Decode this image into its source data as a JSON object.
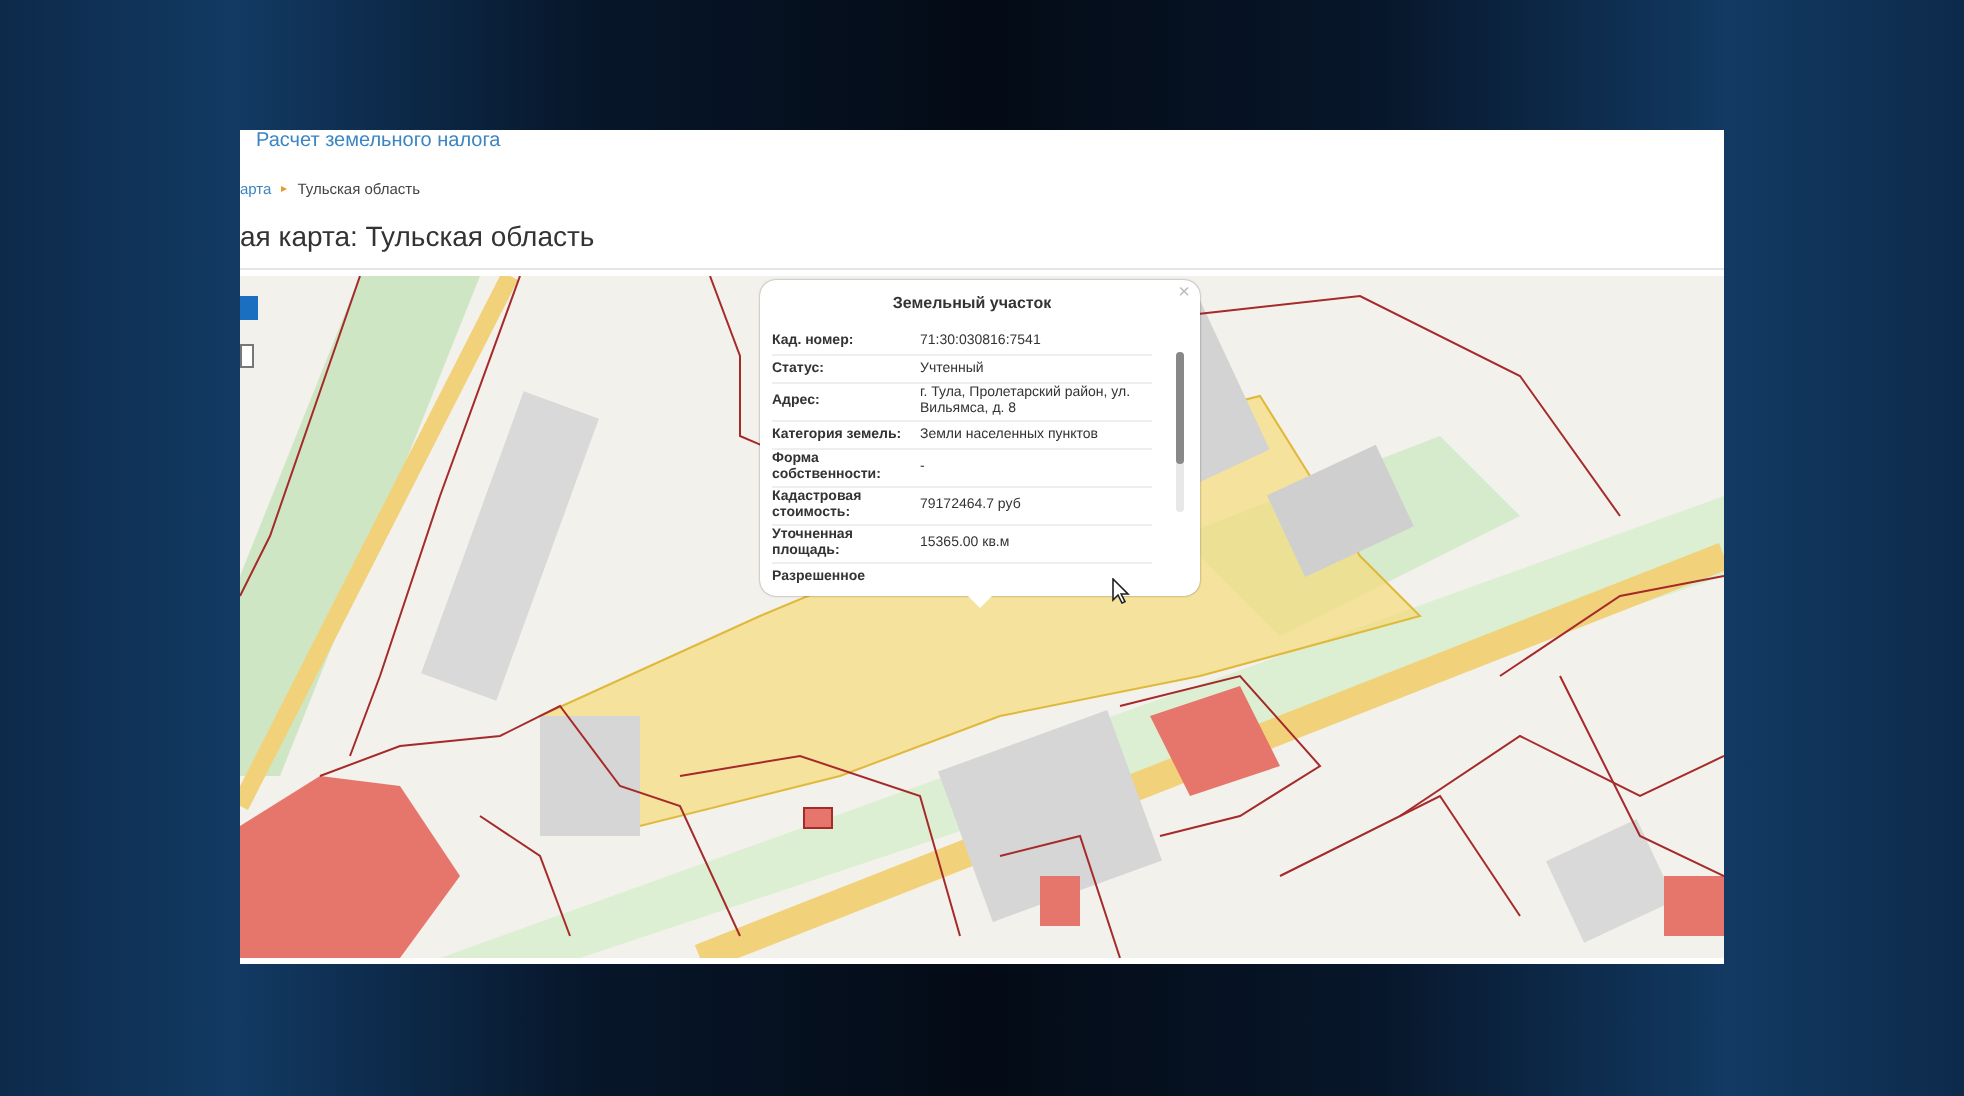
{
  "site_link": "Расчет земельного налога",
  "breadcrumb": [
    {
      "label": "арта",
      "kind": "link"
    },
    {
      "label": "Тульская область",
      "kind": "current",
      "separator": "▸"
    }
  ],
  "page_title": "ая карта: Тульская область",
  "popup": {
    "title": "Земельный участок",
    "close": "×",
    "rows": [
      {
        "label": "Кад. номер:",
        "value": "71:30:030816:7541"
      },
      {
        "label": "Статус:",
        "value": "Учтенный"
      },
      {
        "label": "Адрес:",
        "value": "г. Тула, Пролетарский район, ул. Вильямса, д. 8"
      },
      {
        "label": "Категория земель:",
        "value": "Земли населенных пунктов"
      },
      {
        "label": "Форма собственности:",
        "value": "-"
      },
      {
        "label": "Кадастровая стоимость:",
        "value": "79172464.7 руб"
      },
      {
        "label": "Уточненная площадь:",
        "value": "15365.00 кв.м"
      },
      {
        "label": "Разрешенное"
      }
    ]
  }
}
